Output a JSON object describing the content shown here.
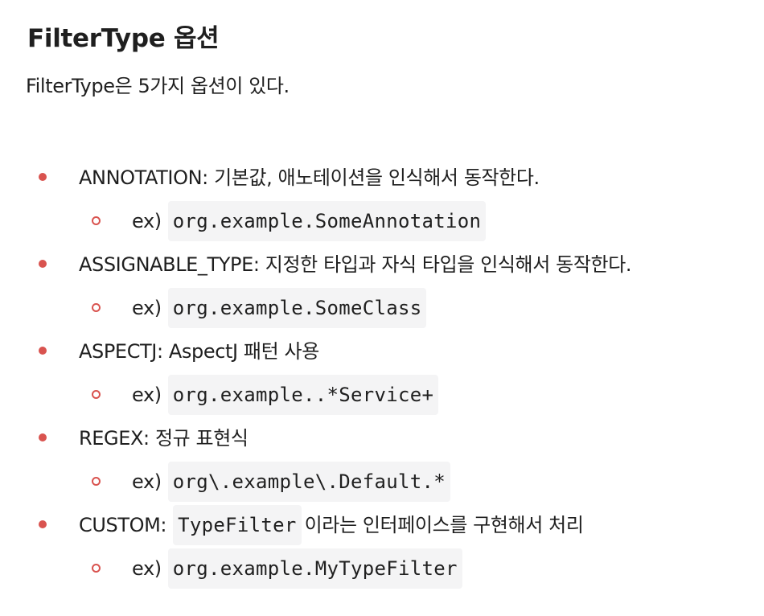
{
  "title": "FilterType 옵션",
  "intro": "FilterType은 5가지 옵션이 있다.",
  "options": [
    {
      "text": "ANNOTATION: 기본값, 애노테이션을 인식해서 동작한다.",
      "ex_prefix": "ex)",
      "example": "org.example.SomeAnnotation"
    },
    {
      "text": "ASSIGNABLE_TYPE: 지정한 타입과 자식 타입을 인식해서 동작한다.",
      "ex_prefix": "ex)",
      "example": "org.example.SomeClass"
    },
    {
      "text": "ASPECTJ: AspectJ 패턴 사용",
      "ex_prefix": "ex)",
      "example": "org.example..*Service+"
    },
    {
      "text": "REGEX: 정규 표현식",
      "ex_prefix": "ex)",
      "example": "org\\.example\\.Default.*"
    },
    {
      "text_before": "CUSTOM:",
      "inline_code": "TypeFilter",
      "text_after": "이라는 인터페이스를 구현해서 처리",
      "ex_prefix": "ex)",
      "example": "org.example.MyTypeFilter"
    }
  ]
}
